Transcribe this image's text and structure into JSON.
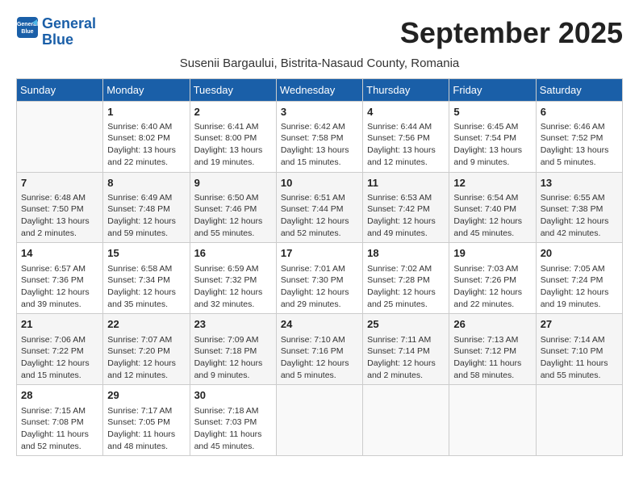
{
  "logo": {
    "line1": "General",
    "line2": "Blue"
  },
  "title": "September 2025",
  "subtitle": "Susenii Bargaului, Bistrita-Nasaud County, Romania",
  "weekdays": [
    "Sunday",
    "Monday",
    "Tuesday",
    "Wednesday",
    "Thursday",
    "Friday",
    "Saturday"
  ],
  "weeks": [
    [
      {
        "day": "",
        "info": ""
      },
      {
        "day": "1",
        "info": "Sunrise: 6:40 AM\nSunset: 8:02 PM\nDaylight: 13 hours\nand 22 minutes."
      },
      {
        "day": "2",
        "info": "Sunrise: 6:41 AM\nSunset: 8:00 PM\nDaylight: 13 hours\nand 19 minutes."
      },
      {
        "day": "3",
        "info": "Sunrise: 6:42 AM\nSunset: 7:58 PM\nDaylight: 13 hours\nand 15 minutes."
      },
      {
        "day": "4",
        "info": "Sunrise: 6:44 AM\nSunset: 7:56 PM\nDaylight: 13 hours\nand 12 minutes."
      },
      {
        "day": "5",
        "info": "Sunrise: 6:45 AM\nSunset: 7:54 PM\nDaylight: 13 hours\nand 9 minutes."
      },
      {
        "day": "6",
        "info": "Sunrise: 6:46 AM\nSunset: 7:52 PM\nDaylight: 13 hours\nand 5 minutes."
      }
    ],
    [
      {
        "day": "7",
        "info": "Sunrise: 6:48 AM\nSunset: 7:50 PM\nDaylight: 13 hours\nand 2 minutes."
      },
      {
        "day": "8",
        "info": "Sunrise: 6:49 AM\nSunset: 7:48 PM\nDaylight: 12 hours\nand 59 minutes."
      },
      {
        "day": "9",
        "info": "Sunrise: 6:50 AM\nSunset: 7:46 PM\nDaylight: 12 hours\nand 55 minutes."
      },
      {
        "day": "10",
        "info": "Sunrise: 6:51 AM\nSunset: 7:44 PM\nDaylight: 12 hours\nand 52 minutes."
      },
      {
        "day": "11",
        "info": "Sunrise: 6:53 AM\nSunset: 7:42 PM\nDaylight: 12 hours\nand 49 minutes."
      },
      {
        "day": "12",
        "info": "Sunrise: 6:54 AM\nSunset: 7:40 PM\nDaylight: 12 hours\nand 45 minutes."
      },
      {
        "day": "13",
        "info": "Sunrise: 6:55 AM\nSunset: 7:38 PM\nDaylight: 12 hours\nand 42 minutes."
      }
    ],
    [
      {
        "day": "14",
        "info": "Sunrise: 6:57 AM\nSunset: 7:36 PM\nDaylight: 12 hours\nand 39 minutes."
      },
      {
        "day": "15",
        "info": "Sunrise: 6:58 AM\nSunset: 7:34 PM\nDaylight: 12 hours\nand 35 minutes."
      },
      {
        "day": "16",
        "info": "Sunrise: 6:59 AM\nSunset: 7:32 PM\nDaylight: 12 hours\nand 32 minutes."
      },
      {
        "day": "17",
        "info": "Sunrise: 7:01 AM\nSunset: 7:30 PM\nDaylight: 12 hours\nand 29 minutes."
      },
      {
        "day": "18",
        "info": "Sunrise: 7:02 AM\nSunset: 7:28 PM\nDaylight: 12 hours\nand 25 minutes."
      },
      {
        "day": "19",
        "info": "Sunrise: 7:03 AM\nSunset: 7:26 PM\nDaylight: 12 hours\nand 22 minutes."
      },
      {
        "day": "20",
        "info": "Sunrise: 7:05 AM\nSunset: 7:24 PM\nDaylight: 12 hours\nand 19 minutes."
      }
    ],
    [
      {
        "day": "21",
        "info": "Sunrise: 7:06 AM\nSunset: 7:22 PM\nDaylight: 12 hours\nand 15 minutes."
      },
      {
        "day": "22",
        "info": "Sunrise: 7:07 AM\nSunset: 7:20 PM\nDaylight: 12 hours\nand 12 minutes."
      },
      {
        "day": "23",
        "info": "Sunrise: 7:09 AM\nSunset: 7:18 PM\nDaylight: 12 hours\nand 9 minutes."
      },
      {
        "day": "24",
        "info": "Sunrise: 7:10 AM\nSunset: 7:16 PM\nDaylight: 12 hours\nand 5 minutes."
      },
      {
        "day": "25",
        "info": "Sunrise: 7:11 AM\nSunset: 7:14 PM\nDaylight: 12 hours\nand 2 minutes."
      },
      {
        "day": "26",
        "info": "Sunrise: 7:13 AM\nSunset: 7:12 PM\nDaylight: 11 hours\nand 58 minutes."
      },
      {
        "day": "27",
        "info": "Sunrise: 7:14 AM\nSunset: 7:10 PM\nDaylight: 11 hours\nand 55 minutes."
      }
    ],
    [
      {
        "day": "28",
        "info": "Sunrise: 7:15 AM\nSunset: 7:08 PM\nDaylight: 11 hours\nand 52 minutes."
      },
      {
        "day": "29",
        "info": "Sunrise: 7:17 AM\nSunset: 7:05 PM\nDaylight: 11 hours\nand 48 minutes."
      },
      {
        "day": "30",
        "info": "Sunrise: 7:18 AM\nSunset: 7:03 PM\nDaylight: 11 hours\nand 45 minutes."
      },
      {
        "day": "",
        "info": ""
      },
      {
        "day": "",
        "info": ""
      },
      {
        "day": "",
        "info": ""
      },
      {
        "day": "",
        "info": ""
      }
    ]
  ]
}
